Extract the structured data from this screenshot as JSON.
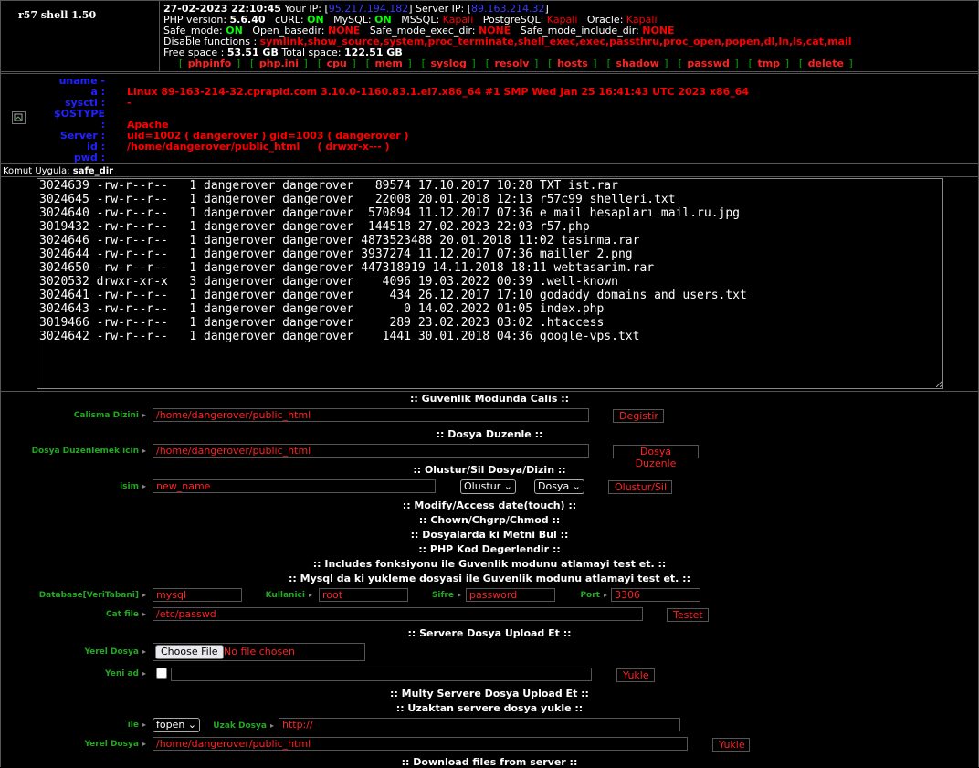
{
  "header": {
    "title": "r57 shell 1.50",
    "datetime": "27-02-2023 22:10:45",
    "your_ip_label": "Your IP: [",
    "your_ip": "95.217.194.182",
    "server_ip_label": "] Server IP: [",
    "server_ip": "89.163.214.32",
    "server_ip_close": "]",
    "php_version_label": "PHP version:",
    "php_version": "5.6.40",
    "curl_label": "cURL:",
    "curl": "ON",
    "mysql_label": "MySQL:",
    "mysql": "ON",
    "mssql_label": "MSSQL:",
    "mssql": "Kapali",
    "postgresql_label": "PostgreSQL:",
    "postgresql": "Kapali",
    "oracle_label": "Oracle:",
    "oracle": "Kapali",
    "safe_mode_label": "Safe_mode:",
    "safe_mode": "ON",
    "open_basedir_label": "Open_basedir:",
    "open_basedir": "NONE",
    "safe_mode_exec_dir_label": "Safe_mode_exec_dir:",
    "safe_mode_exec_dir": "NONE",
    "safe_mode_include_dir_label": "Safe_mode_include_dir:",
    "safe_mode_include_dir": "NONE",
    "disable_functions_label": "Disable functions :",
    "disable_functions": "symlink,show_source,system,proc_terminate,shell_exec,exec,passthru,proc_open,popen,dl,ln,ls,cat,mail",
    "free_space_label": "Free space :",
    "free_space": "53.51 GB",
    "total_space_label": "Total space:",
    "total_space": "122.51 GB"
  },
  "menu": [
    "phpinfo",
    "php.ini",
    "cpu",
    "mem",
    "syslog",
    "resolv",
    "hosts",
    "shadow",
    "passwd",
    "tmp",
    "delete"
  ],
  "sysinfo": {
    "labels": [
      "uname -a :",
      "sysctl :",
      "$OSTYPE :",
      "Server :",
      "id :",
      "pwd :"
    ],
    "uname": "Linux 89-163-214-32.cprapid.com 3.10.0-1160.83.1.el7.x86_64 #1 SMP Wed Jan 25 16:41:43 UTC 2023 x86_64",
    "sysctl": "-",
    "server": "Apache",
    "id": "uid=1002 ( dangerover ) gid=1003 ( dangerover )",
    "pwd": "/home/dangerover/public_html",
    "perms": "( drwxr-x--- )"
  },
  "command": {
    "label": "Komut Uygula:",
    "value": "safe_dir"
  },
  "output_lines": [
    "3024639 -rw-r--r--   1 dangerover dangerover   89574 17.10.2017 10:28 TXT ist.rar",
    "3024645 -rw-r--r--   1 dangerover dangerover   22008 20.01.2018 12:13 r57c99 shelleri.txt",
    "3024640 -rw-r--r--   1 dangerover dangerover  570894 11.12.2017 07:36 e mail hesapları mail.ru.jpg",
    "3019432 -rw-r--r--   1 dangerover dangerover  144518 27.02.2023 22:03 r57.php",
    "3024646 -rw-r--r--   1 dangerover dangerover 4873523488 20.01.2018 11:02 tasinma.rar",
    "3024644 -rw-r--r--   1 dangerover dangerover 3937274 11.12.2017 07:36 mailler 2.png",
    "3024650 -rw-r--r--   1 dangerover dangerover 447318919 14.11.2018 18:11 webtasarim.rar",
    "3020532 drwxr-xr-x   3 dangerover dangerover    4096 19.03.2022 00:39 .well-known",
    "3024641 -rw-r--r--   1 dangerover dangerover     434 26.12.2017 17:10 godaddy domains and users.txt",
    "3024643 -rw-r--r--   1 dangerover dangerover       0 14.02.2022 01:05 index.php",
    "3019466 -rw-r--r--   1 dangerover dangerover     289 23.02.2023 03:02 .htaccess",
    "3024642 -rw-r--r--   1 dangerover dangerover    1441 30.01.2018 04:36 google-vps.txt"
  ],
  "sections": {
    "safe_mode": ":: Guvenlik Modunda Calis ::",
    "file_edit": ":: Dosya Duzenle ::",
    "create_delete": ":: Olustur/Sil Dosya/Dizin ::",
    "touch": ":: Modify/Access date(touch) ::",
    "chown": ":: Chown/Chgrp/Chmod ::",
    "find_text": ":: Dosyalarda ki Metni Bul ::",
    "php_eval": ":: PHP Kod Degerlendir ::",
    "includes": ":: Includes fonksiyonu ile Guvenlik modunu atlamayi test et. ::",
    "mysql_bypass": ":: Mysql da ki yukleme dosyasi ile Guvenlik modunu atlamayi test et. ::",
    "upload": ":: Servere Dosya Upload Et ::",
    "multi_upload": ":: Multy Servere Dosya Upload Et ::",
    "remote_upload": ":: Uzaktan servere dosya yukle ::",
    "download": ":: Download files from server ::"
  },
  "form": {
    "workdir_label": "Calisma Dizini",
    "workdir_value": "/home/dangerover/public_html",
    "workdir_button": "Degistir",
    "edit_label": "Dosya Duzenlemek icin",
    "edit_value": "/home/dangerover/public_html",
    "edit_button": "Dosya Duzenle",
    "name_label": "isim",
    "name_value": "new_name",
    "action_select": "Olustur",
    "type_select": "Dosya",
    "create_button": "Olustur/Sil",
    "db_label": "Database[VeriTabani]",
    "db_value": "mysql",
    "user_label": "Kullanici",
    "user_value": "root",
    "pass_label": "Sifre",
    "pass_value": "password",
    "port_label": "Port",
    "port_value": "3306",
    "cat_label": "Cat file",
    "cat_value": "/etc/passwd",
    "test_button": "Testet",
    "local_file_label": "Yerel Dosya",
    "choose_file": "Choose File",
    "no_file": "No file chosen",
    "new_name_label": "Yeni ad",
    "upload_button": "Yukle",
    "with_label": "ile",
    "method_select": "fopen",
    "remote_file_label": "Uzak Dosya",
    "remote_file_value": "http://",
    "local_file2_label": "Yerel Dosya",
    "local_file2_value": "/home/dangerover/public_html",
    "upload2_button": "Yukle"
  }
}
